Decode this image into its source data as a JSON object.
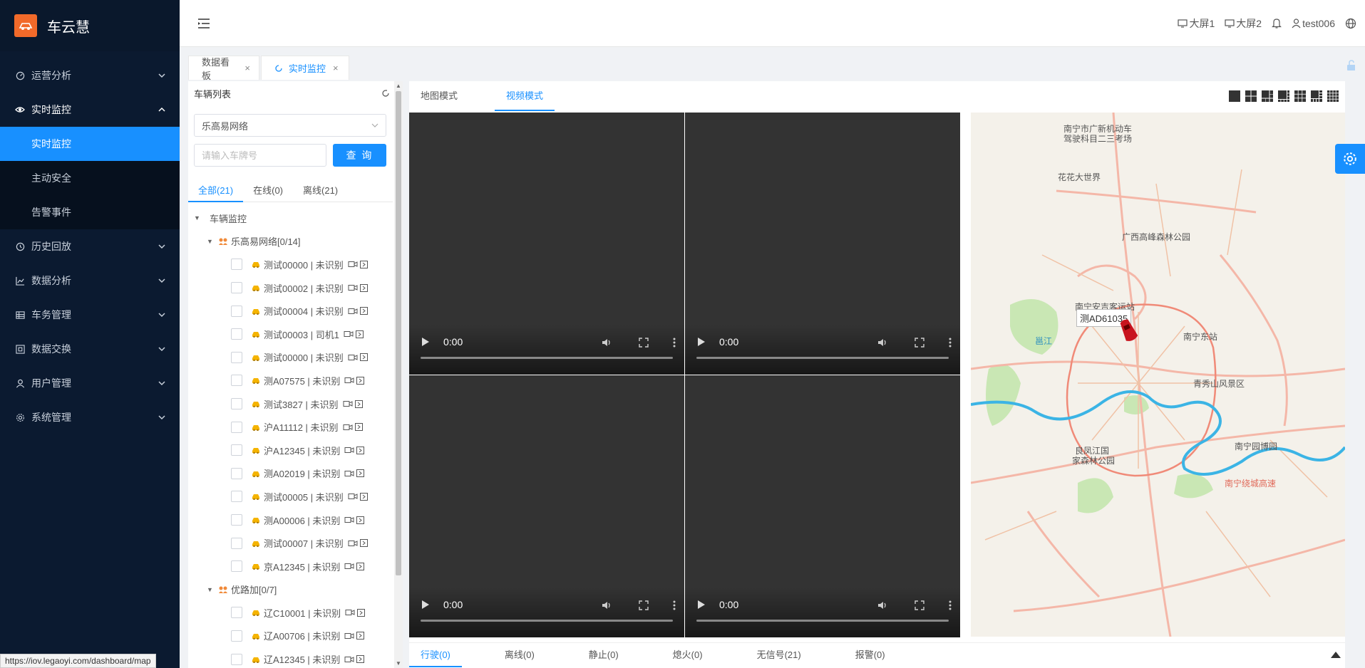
{
  "app": {
    "logo_text": "车云慧",
    "logo_mark": "车云慧"
  },
  "sidebar": {
    "items": [
      {
        "label": "运营分析",
        "icon": "dashboard-icon"
      },
      {
        "label": "实时监控",
        "icon": "eye-icon",
        "open": true,
        "children": [
          {
            "label": "实时监控",
            "active": true
          },
          {
            "label": "主动安全"
          },
          {
            "label": "告警事件"
          }
        ]
      },
      {
        "label": "历史回放",
        "icon": "clock-icon"
      },
      {
        "label": "数据分析",
        "icon": "line-chart-icon"
      },
      {
        "label": "车务管理",
        "icon": "grid-icon"
      },
      {
        "label": "数据交换",
        "icon": "exchange-icon"
      },
      {
        "label": "用户管理",
        "icon": "user-icon"
      },
      {
        "label": "系统管理",
        "icon": "gear-icon"
      }
    ]
  },
  "header": {
    "screen1": "大屏1",
    "screen2": "大屏2",
    "username": "test006"
  },
  "tabs": [
    {
      "label": "数据看板",
      "active": false
    },
    {
      "label": "实时监控",
      "active": true
    }
  ],
  "vehicle_panel": {
    "title": "车辆列表",
    "company_select": "乐高易网络",
    "search_placeholder": "请输入车牌号",
    "query_button": "查 询",
    "filters": [
      "全部(21)",
      "在线(0)",
      "离线(21)"
    ],
    "tree_root": "车辆监控",
    "groups": [
      {
        "name": "乐高易网络[0/14]",
        "vehicles": [
          "测试00000 | 未识别",
          "测试00002 | 未识别",
          "测试00004 | 未识别",
          "测试00003 | 司机1",
          "测试00000 | 未识别",
          "测A07575 | 未识别",
          "测试3827 | 未识别",
          "沪A11112 | 未识别",
          "沪A12345 | 未识别",
          "测A02019 | 未识别",
          "测试00005 | 未识别",
          "测A00006 | 未识别",
          "测试00007 | 未识别",
          "京A12345 | 未识别"
        ]
      },
      {
        "name": "优路加[0/7]",
        "vehicles": [
          "辽C10001 | 未识别",
          "辽A00706 | 未识别",
          "辽A12345 | 未识别"
        ]
      }
    ]
  },
  "main": {
    "mode_tabs": [
      "地图模式",
      "视频模式"
    ],
    "active_mode": "视频模式",
    "videos": [
      {
        "time": "0:00"
      },
      {
        "time": "0:00"
      },
      {
        "time": "0:00"
      },
      {
        "time": "0:00"
      }
    ],
    "map": {
      "labels": [
        "南宁市广新机动车",
        "驾驶科目二三考场",
        "花花大世界",
        "广西高峰森林公园",
        "南宁安吉客运站",
        "邕江",
        "南宁东站",
        "青秀山风景区",
        "良凤江国",
        "家森林公园",
        "南宁园博园",
        "南宁绕城高速"
      ],
      "vehicle_tag": "测AD61035"
    },
    "status_tabs": [
      "行驶(0)",
      "离线(0)",
      "静止(0)",
      "熄火(0)",
      "无信号(21)",
      "报警(0)"
    ]
  },
  "status_url": "https://iov.legaoyi.com/dashboard/map",
  "colors": {
    "primary": "#1890ff",
    "sidebar_bg": "#0b1a30",
    "logo": "#f26a2a",
    "car_yellow": "#f5b400"
  }
}
